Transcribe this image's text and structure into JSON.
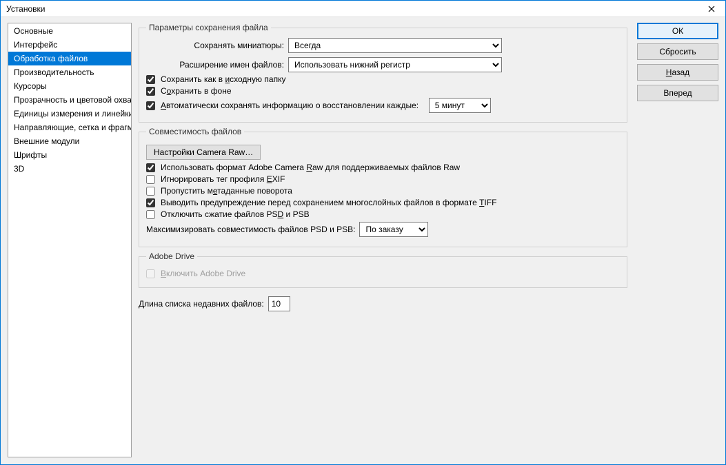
{
  "title": "Установки",
  "sidebar": {
    "items": [
      {
        "label": "Основные"
      },
      {
        "label": "Интерфейс"
      },
      {
        "label": "Обработка файлов"
      },
      {
        "label": "Производительность"
      },
      {
        "label": "Курсоры"
      },
      {
        "label": "Прозрачность и цветовой охват"
      },
      {
        "label": "Единицы измерения и линейки"
      },
      {
        "label": "Направляющие, сетка и фрагменты"
      },
      {
        "label": "Внешние модули"
      },
      {
        "label": "Шрифты"
      },
      {
        "label": "3D"
      }
    ],
    "selected_index": 2
  },
  "buttons": {
    "ok": "ОК",
    "reset": "Сбросить",
    "back_pre": "",
    "back_u": "Н",
    "back_post": "азад",
    "forward_pre": "Впере",
    "forward_u": "д",
    "forward_post": ""
  },
  "save_group": {
    "legend": "Параметры сохранения файла",
    "preview_label": "Сохранять миниатюры:",
    "preview_value": "Всегда",
    "ext_label": "Расширение имен файлов:",
    "ext_value": "Использовать нижний регистр",
    "save_as_orig_pre": "Сохранить как в ",
    "save_as_orig_u": "и",
    "save_as_orig_post": "сходную папку",
    "save_bg_pre": "С",
    "save_bg_u": "о",
    "save_bg_post": "хранить в фоне",
    "autosave_pre": "",
    "autosave_u": "А",
    "autosave_post": "втоматически сохранять информацию о восстановлении каждые:",
    "autosave_interval": "5 минут",
    "save_as_orig_checked": true,
    "save_bg_checked": true,
    "autosave_checked": true
  },
  "compat_group": {
    "legend": "Совместимость файлов",
    "camera_raw_btn": "Настройки Camera Raw…",
    "use_acr_pre": "Использовать формат Adobe Camera ",
    "use_acr_u": "R",
    "use_acr_post": "aw для поддерживаемых файлов Raw",
    "ignore_exif_pre": "Игнорировать тег профиля ",
    "ignore_exif_u": "E",
    "ignore_exif_post": "XIF",
    "skip_rotate_pre": "Пропустить м",
    "skip_rotate_u": "е",
    "skip_rotate_post": "таданные поворота",
    "tiff_warn_pre": "Выводить предупреждение перед сохранением многослойных файлов в формате ",
    "tiff_warn_u": "T",
    "tiff_warn_post": "IFF",
    "disable_psd_pre": "Отключить сжатие файлов PS",
    "disable_psd_u": "D",
    "disable_psd_post": " и PSB",
    "maximize_label": "Максимизировать совместимость файлов PSD и PSB:",
    "maximize_value": "По заказу",
    "use_acr_checked": true,
    "ignore_exif_checked": false,
    "skip_rotate_checked": false,
    "tiff_warn_checked": true,
    "disable_psd_checked": false
  },
  "drive_group": {
    "legend": "Adobe Drive",
    "enable_pre": "",
    "enable_u": "В",
    "enable_post": "ключить Adobe Drive",
    "enable_checked": false
  },
  "recent": {
    "label": "Длина списка недавних файлов:",
    "value": "10"
  }
}
